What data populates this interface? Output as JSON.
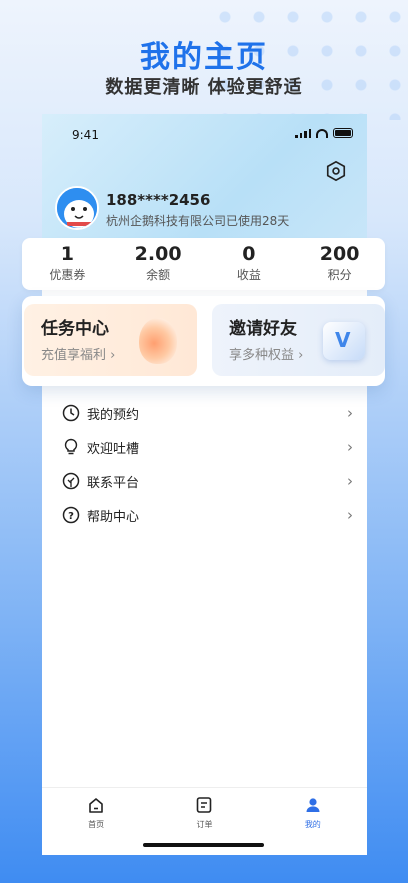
{
  "hero": {
    "title": "我的主页",
    "subtitle": "数据更清晰 体验更舒适"
  },
  "status_bar": {
    "time": "9:41"
  },
  "profile": {
    "phone": "188****2456",
    "company_line": "杭州企鹅科技有限公司已使用28天"
  },
  "stats": [
    {
      "value": "1",
      "label": "优惠券"
    },
    {
      "value": "2.00",
      "label": "余额"
    },
    {
      "value": "0",
      "label": "收益"
    },
    {
      "value": "200",
      "label": "积分"
    }
  ],
  "cards": {
    "task": {
      "title": "任务中心",
      "subtitle": "充值享福利 ›"
    },
    "invite": {
      "title": "邀请好友",
      "subtitle": "享多种权益 ›"
    }
  },
  "menu": [
    {
      "label": "我的预约",
      "icon": "clock-icon"
    },
    {
      "label": "欢迎吐槽",
      "icon": "lightbulb-icon"
    },
    {
      "label": "联系平台",
      "icon": "leaf-icon"
    },
    {
      "label": "帮助中心",
      "icon": "help-icon"
    }
  ],
  "tabbar": [
    {
      "label": "首页",
      "icon": "home-icon"
    },
    {
      "label": "订单",
      "icon": "order-icon"
    },
    {
      "label": "我的",
      "icon": "profile-icon",
      "active": true
    }
  ],
  "colors": {
    "accent": "#1f72ea",
    "tab_active": "#2f6fe6"
  }
}
